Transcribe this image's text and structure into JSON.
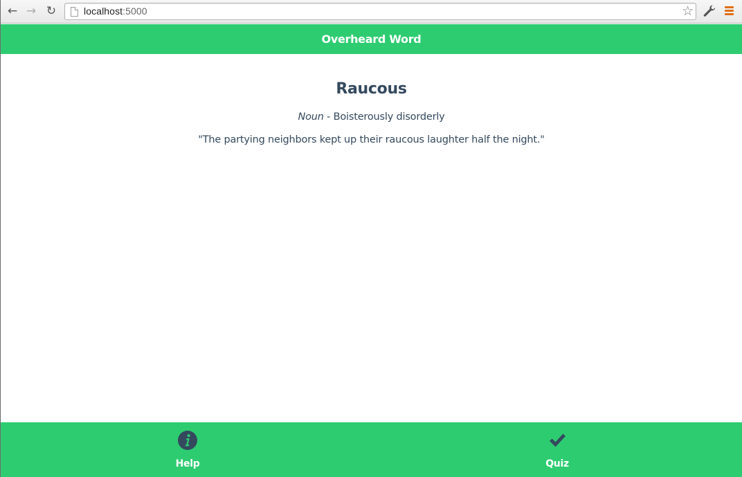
{
  "browser": {
    "url_host": "localhost",
    "url_port": ":5000",
    "back_icon": "arrow-left-icon",
    "forward_icon": "arrow-right-icon",
    "reload_icon": "reload-icon",
    "bookmark_icon": "star-icon",
    "tools_icon": "wrench-icon",
    "menu_icon": "hamburger-menu-icon"
  },
  "header": {
    "title": "Overheard Word"
  },
  "word_card": {
    "word": "Raucous",
    "part_of_speech": "Noun",
    "separator": " - ",
    "definition": "Boisterously disorderly",
    "example": "\"The partying neighbors kept up their raucous laughter half the night.\""
  },
  "footer": {
    "items": [
      {
        "label": "Help",
        "icon": "info-icon"
      },
      {
        "label": "Quiz",
        "icon": "checkmark-icon"
      }
    ]
  },
  "colors": {
    "accent": "#2ecc71",
    "text": "#34495e",
    "icon": "#34495e"
  }
}
